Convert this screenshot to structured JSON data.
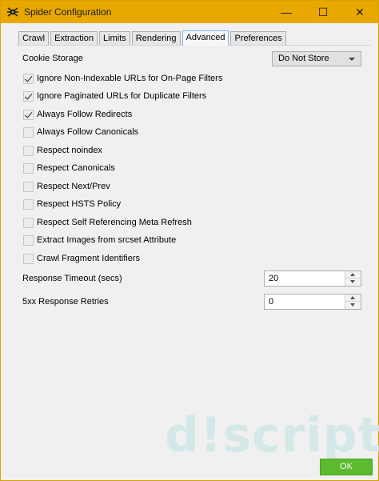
{
  "window": {
    "title": "Spider Configuration",
    "minimize": "—",
    "maximize": "☐",
    "close": "✕"
  },
  "tabs": [
    {
      "label": "Crawl",
      "active": false
    },
    {
      "label": "Extraction",
      "active": false
    },
    {
      "label": "Limits",
      "active": false
    },
    {
      "label": "Rendering",
      "active": false
    },
    {
      "label": "Advanced",
      "active": true
    },
    {
      "label": "Preferences",
      "active": false
    }
  ],
  "cookie_storage": {
    "label": "Cookie Storage",
    "value": "Do Not Store"
  },
  "options": [
    {
      "label": "Ignore Non-Indexable URLs for On-Page Filters",
      "checked": true
    },
    {
      "label": "Ignore Paginated URLs for Duplicate Filters",
      "checked": true
    },
    {
      "label": "Always Follow Redirects",
      "checked": true
    },
    {
      "label": "Always Follow Canonicals",
      "checked": false
    },
    {
      "label": "Respect noindex",
      "checked": false
    },
    {
      "label": "Respect Canonicals",
      "checked": false
    },
    {
      "label": "Respect Next/Prev",
      "checked": false
    },
    {
      "label": "Respect HSTS Policy",
      "checked": false
    },
    {
      "label": "Respect Self Referencing Meta Refresh",
      "checked": false
    },
    {
      "label": "Extract Images from srcset Attribute",
      "checked": false
    },
    {
      "label": "Crawl Fragment Identifiers",
      "checked": false
    }
  ],
  "response_timeout": {
    "label": "Response Timeout (secs)",
    "value": "20"
  },
  "retries": {
    "label": "5xx Response Retries",
    "value": "0"
  },
  "watermark": "d!script",
  "ok_label": "OK",
  "colors": {
    "titlebar": "#e8a800",
    "ok_button": "#5cba2e",
    "active_tab_border": "#7eb4ea"
  }
}
